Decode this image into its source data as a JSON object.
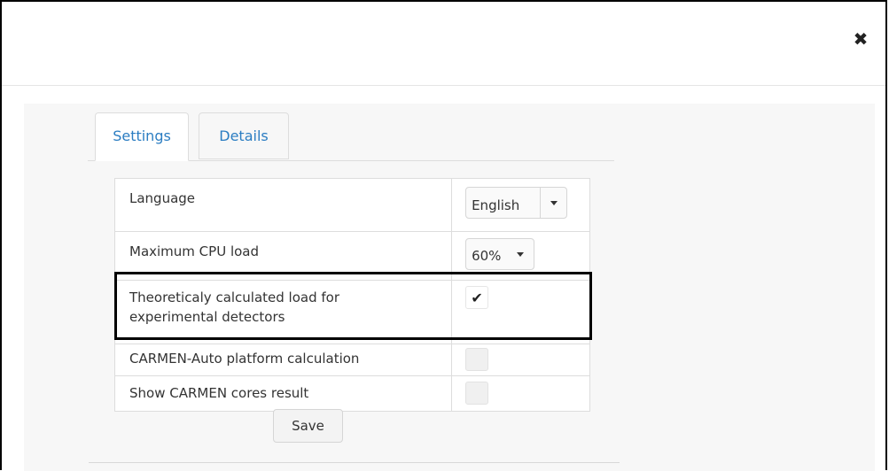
{
  "header": {
    "close_glyph": "✖"
  },
  "tabs": [
    {
      "label": "Settings",
      "active": true
    },
    {
      "label": "Details",
      "active": false
    }
  ],
  "settings": {
    "language": {
      "label": "Language",
      "value": "English"
    },
    "cpu_load": {
      "label": "Maximum CPU load",
      "value": "60%"
    },
    "theoretical": {
      "label_line1": "Theoreticaly calculated load for",
      "label_line2": "experimental detectors",
      "checked": true,
      "check_glyph": "✔"
    },
    "carmen_auto": {
      "label": "CARMEN-Auto platform calculation",
      "checked": false
    },
    "carmen_cores": {
      "label": "Show CARMEN cores result",
      "checked": false
    }
  },
  "actions": {
    "save_label": "Save"
  },
  "colors": {
    "tab_link": "#2b7dc2",
    "highlight_border": "#000000",
    "body_bg": "#f7f7f7"
  }
}
